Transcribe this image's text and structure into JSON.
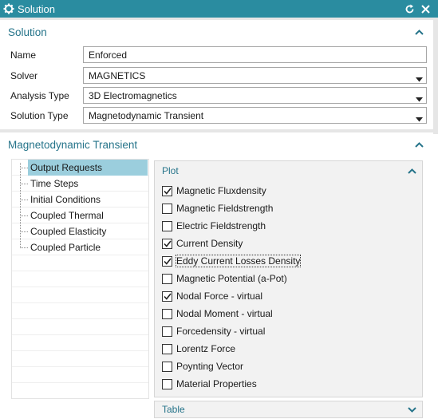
{
  "window": {
    "title": "Solution"
  },
  "solution_panel": {
    "heading": "Solution",
    "rows": [
      {
        "label": "Name",
        "value": "Enforced"
      },
      {
        "label": "Solver",
        "value": "MAGNETICS"
      },
      {
        "label": "Analysis Type",
        "value": "3D Electromagnetics"
      },
      {
        "label": "Solution Type",
        "value": "Magnetodynamic Transient"
      }
    ]
  },
  "transient_panel": {
    "heading": "Magnetodynamic Transient",
    "tree": [
      {
        "label": "Output Requests",
        "selected": true
      },
      {
        "label": "Time Steps",
        "selected": false
      },
      {
        "label": "Initial Conditions",
        "selected": false
      },
      {
        "label": "Coupled Thermal",
        "selected": false
      },
      {
        "label": "Coupled Elasticity",
        "selected": false
      },
      {
        "label": "Coupled Particle",
        "selected": false
      }
    ],
    "plot": {
      "heading": "Plot",
      "items": [
        {
          "label": "Magnetic Fluxdensity",
          "checked": true
        },
        {
          "label": "Magnetic Fieldstrength",
          "checked": false
        },
        {
          "label": "Electric Fieldstrength",
          "checked": false
        },
        {
          "label": "Current Density",
          "checked": true
        },
        {
          "label": "Eddy Current Losses Density",
          "checked": true
        },
        {
          "label": "Magnetic Potential (a-Pot)",
          "checked": false
        },
        {
          "label": "Nodal Force - virtual",
          "checked": true
        },
        {
          "label": "Nodal Moment - virtual",
          "checked": false
        },
        {
          "label": "Forcedensity - virtual",
          "checked": false
        },
        {
          "label": "Lorentz Force",
          "checked": false
        },
        {
          "label": "Poynting Vector",
          "checked": false
        },
        {
          "label": "Material Properties",
          "checked": false
        }
      ]
    },
    "table": {
      "heading": "Table"
    }
  },
  "colors": {
    "titlebar": "#2a8ca0",
    "accent_text": "#26748a",
    "selection": "#9bcedd"
  },
  "icons": {
    "title": "gear-icon",
    "reset": "reset-icon",
    "close": "close-icon"
  }
}
